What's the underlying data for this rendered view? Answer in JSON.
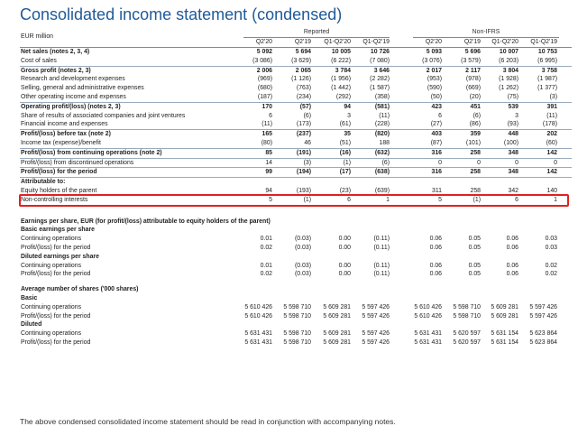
{
  "title": "Consolidated income statement (condensed)",
  "unit_label": "EUR million",
  "groups": {
    "reported": "Reported",
    "non_ifrs": "Non-IFRS"
  },
  "columns": [
    "Q2'20",
    "Q2'19",
    "Q1-Q2'20",
    "Q1-Q2'19",
    "Q2'20",
    "Q2'19",
    "Q1-Q2'20",
    "Q1-Q2'19"
  ],
  "rows": [
    {
      "label": "Net sales (notes 2, 3, 4)",
      "values": [
        "5 092",
        "5 694",
        "10 005",
        "10 726",
        "5 093",
        "5 696",
        "10 007",
        "10 753"
      ],
      "bold": true
    },
    {
      "label": "Cost of sales",
      "values": [
        "(3 086)",
        "(3 629)",
        "(6 222)",
        "(7 080)",
        "(3 076)",
        "(3 579)",
        "(6 203)",
        "(6 995)"
      ],
      "line": true
    },
    {
      "label": "Gross profit (notes 2, 3)",
      "values": [
        "2 006",
        "2 065",
        "3 784",
        "3 646",
        "2 017",
        "2 117",
        "3 804",
        "3 758"
      ],
      "bold": true
    },
    {
      "label": "Research and development expenses",
      "values": [
        "(969)",
        "(1 126)",
        "(1 956)",
        "(2 282)",
        "(953)",
        "(978)",
        "(1 928)",
        "(1 987)"
      ]
    },
    {
      "label": "Selling, general and administrative expenses",
      "values": [
        "(680)",
        "(763)",
        "(1 442)",
        "(1 587)",
        "(590)",
        "(669)",
        "(1 262)",
        "(1 377)"
      ]
    },
    {
      "label": "Other operating income and expenses",
      "values": [
        "(187)",
        "(234)",
        "(292)",
        "(358)",
        "(50)",
        "(20)",
        "(75)",
        "(3)"
      ],
      "line": true
    },
    {
      "label": "Operating profit/(loss) (notes 2, 3)",
      "values": [
        "170",
        "(57)",
        "94",
        "(581)",
        "423",
        "451",
        "539",
        "391"
      ],
      "bold": true
    },
    {
      "label": "Share of results of associated companies and joint ventures",
      "values": [
        "6",
        "(6)",
        "3",
        "(11)",
        "6",
        "(6)",
        "3",
        "(11)"
      ]
    },
    {
      "label": "Financial income and expenses",
      "values": [
        "(11)",
        "(173)",
        "(61)",
        "(228)",
        "(27)",
        "(86)",
        "(93)",
        "(178)"
      ],
      "line": true
    },
    {
      "label": "Profit/(loss) before tax (note 2)",
      "values": [
        "165",
        "(237)",
        "35",
        "(820)",
        "403",
        "359",
        "448",
        "202"
      ],
      "bold": true
    },
    {
      "label": "Income tax (expense)/benefit",
      "values": [
        "(80)",
        "46",
        "(51)",
        "188",
        "(87)",
        "(101)",
        "(100)",
        "(60)"
      ],
      "line": true
    },
    {
      "label": "Profit/(loss) from continuing operations (note 2)",
      "values": [
        "85",
        "(191)",
        "(16)",
        "(632)",
        "316",
        "258",
        "348",
        "142"
      ],
      "bold": true,
      "line": true
    },
    {
      "label": "Profit/(loss) from discontinued operations",
      "values": [
        "14",
        "(3)",
        "(1)",
        "(6)",
        "0",
        "0",
        "0",
        "0"
      ],
      "line": true
    },
    {
      "label": "Profit/(loss) for the period",
      "values": [
        "99",
        "(194)",
        "(17)",
        "(638)",
        "316",
        "258",
        "348",
        "142"
      ],
      "bold": true,
      "line": true
    },
    {
      "label": "Attributable to:",
      "values": [
        "",
        "",
        "",
        "",
        "",
        "",
        "",
        ""
      ],
      "bold": true
    },
    {
      "label": "Equity holders of the parent",
      "values": [
        "94",
        "(193)",
        "(23)",
        "(639)",
        "311",
        "258",
        "342",
        "140"
      ]
    },
    {
      "label": "Non-controlling interests",
      "values": [
        "5",
        "(1)",
        "6",
        "1",
        "5",
        "(1)",
        "6",
        "1"
      ]
    },
    {
      "gap": true
    },
    {
      "gap": true
    },
    {
      "label": "Earnings per share, EUR (for profit/(loss) attributable to equity holders of the parent)",
      "values": [
        "",
        "",
        "",
        "",
        "",
        "",
        "",
        ""
      ],
      "bold": true
    },
    {
      "label": "Basic earnings per share",
      "values": [
        "",
        "",
        "",
        "",
        "",
        "",
        "",
        ""
      ],
      "bold": true
    },
    {
      "label": "Continuing operations",
      "values": [
        "0.01",
        "(0.03)",
        "0.00",
        "(0.11)",
        "0.06",
        "0.05",
        "0.06",
        "0.03"
      ]
    },
    {
      "label": "Profit/(loss) for the period",
      "values": [
        "0.02",
        "(0.03)",
        "0.00",
        "(0.11)",
        "0.06",
        "0.05",
        "0.06",
        "0.03"
      ]
    },
    {
      "label": "Diluted earnings per share",
      "values": [
        "",
        "",
        "",
        "",
        "",
        "",
        "",
        ""
      ],
      "bold": true
    },
    {
      "label": "Continuing operations",
      "values": [
        "0.01",
        "(0.03)",
        "0.00",
        "(0.11)",
        "0.06",
        "0.05",
        "0.06",
        "0.02"
      ]
    },
    {
      "label": "Profit/(loss) for the period",
      "values": [
        "0.02",
        "(0.03)",
        "0.00",
        "(0.11)",
        "0.06",
        "0.05",
        "0.06",
        "0.02"
      ]
    },
    {
      "gap": true
    },
    {
      "label": "Average number of shares ('000 shares)",
      "values": [
        "",
        "",
        "",
        "",
        "",
        "",
        "",
        ""
      ],
      "bold": true
    },
    {
      "label": "Basic",
      "values": [
        "",
        "",
        "",
        "",
        "",
        "",
        "",
        ""
      ],
      "bold": true
    },
    {
      "label": "Continuing operations",
      "values": [
        "5 610 426",
        "5 598 710",
        "5 609 281",
        "5 597 426",
        "5 610 426",
        "5 598 710",
        "5 609 281",
        "5 597 426"
      ]
    },
    {
      "label": "Profit/(loss) for the period",
      "values": [
        "5 610 426",
        "5 598 710",
        "5 609 281",
        "5 597 426",
        "5 610 426",
        "5 598 710",
        "5 609 281",
        "5 597 426"
      ]
    },
    {
      "label": "Diluted",
      "values": [
        "",
        "",
        "",
        "",
        "",
        "",
        "",
        ""
      ],
      "bold": true
    },
    {
      "label": "Continuing operations",
      "values": [
        "5 631 431",
        "5 598 710",
        "5 609 281",
        "5 597 426",
        "5 631 431",
        "5 620 597",
        "5 631 154",
        "5 623 864"
      ]
    },
    {
      "label": "Profit/(loss) for the period",
      "values": [
        "5 631 431",
        "5 598 710",
        "5 609 281",
        "5 597 426",
        "5 631 431",
        "5 620 597",
        "5 631 154",
        "5 623 864"
      ]
    }
  ],
  "footnote": "The above condensed consolidated income statement should be read in conjunction with accompanying notes.",
  "colors": {
    "title": "#1f5a99",
    "highlight": "#e0221f"
  }
}
